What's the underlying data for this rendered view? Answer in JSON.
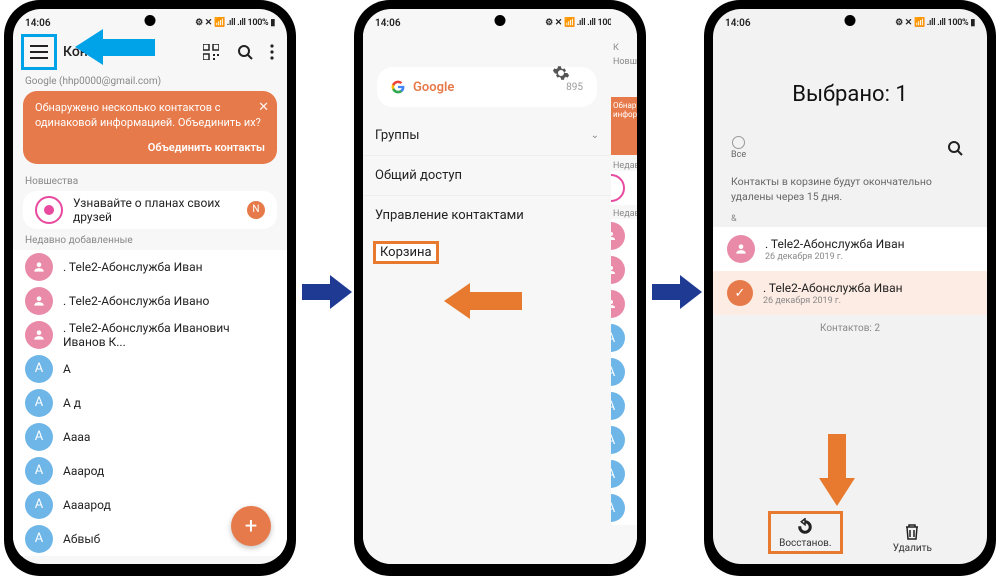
{
  "status": {
    "time": "14:06",
    "right": "⚙ ✕ 📶 .ıll .ıll 100% ▮"
  },
  "phone1": {
    "title": "Контакты",
    "account": "Google (hhp0000@gmail.com)",
    "merge": {
      "text": "Обнаружено несколько контактов с одинаковой информацией. Объединить их?",
      "action": "Объединить контакты"
    },
    "news_header": "Новшества",
    "news_text": "Узнавайте о планах своих друзей",
    "recent_header": "Недавно добавленные",
    "contacts": [
      {
        "name": ". Tele2-Абонслужба Иван",
        "color": "pink"
      },
      {
        "name": ". Tele2-Абонслужба Ивано",
        "color": "pink"
      },
      {
        "name": ". Tele2-Абонслужба Иванович Иванов К...",
        "color": "pink"
      },
      {
        "name": "А",
        "color": "blue",
        "letter": "А"
      },
      {
        "name": "А д",
        "color": "blue",
        "letter": "А"
      },
      {
        "name": "Аааа",
        "color": "blue",
        "letter": "А"
      },
      {
        "name": "Ааарод",
        "color": "blue",
        "letter": "А"
      },
      {
        "name": "Аааарод",
        "color": "blue",
        "letter": "А"
      },
      {
        "name": "Абвыб",
        "color": "blue",
        "letter": "А"
      }
    ]
  },
  "phone2": {
    "google_label": "Google",
    "google_count": "895",
    "menu": {
      "groups": "Группы",
      "share": "Общий доступ",
      "manage": "Управление контактами",
      "trash": "Корзина"
    },
    "peek_headers": {
      "news": "Новш",
      "recent": "Недав"
    },
    "peek_merge": "Обнар\nинфор"
  },
  "phone3": {
    "title": "Выбрано: 1",
    "all_label": "Все",
    "info": "Контакты в корзине будут окончательно удалены через 15 дня.",
    "letter": "&",
    "items": [
      {
        "name": ". Tele2-Абонслужба Иван",
        "date": "26 декабря 2019 г.",
        "selected": false
      },
      {
        "name": ". Tele2-Абонслужба Иван",
        "date": "26 декабря 2019 г.",
        "selected": true
      }
    ],
    "count": "Контактов: 2",
    "restore": "Восстанов.",
    "delete": "Удалить"
  }
}
